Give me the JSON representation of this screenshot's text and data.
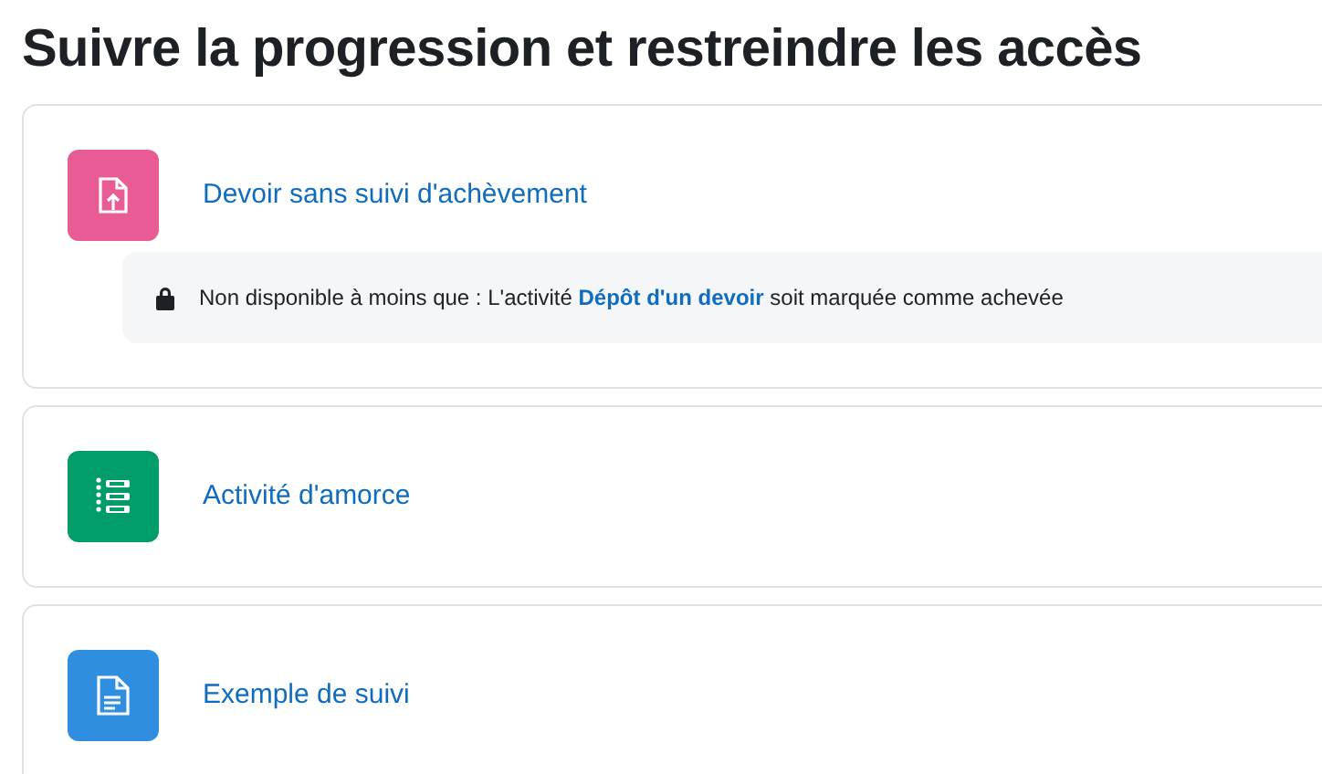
{
  "title": "Suivre la progression et restreindre les accès",
  "activities": [
    {
      "kind": "assignment",
      "color": "#e85b95",
      "name": "Devoir sans suivi d'achèvement",
      "restriction": {
        "before": "Non disponible à moins que : L'activité",
        "link": "Dépôt d'un devoir",
        "after": "soit marquée comme achevée"
      }
    },
    {
      "kind": "feedback",
      "color": "#009c6a",
      "name": "Activité d'amorce"
    },
    {
      "kind": "page",
      "color": "#2f8ee0",
      "name": "Exemple de suivi"
    }
  ]
}
